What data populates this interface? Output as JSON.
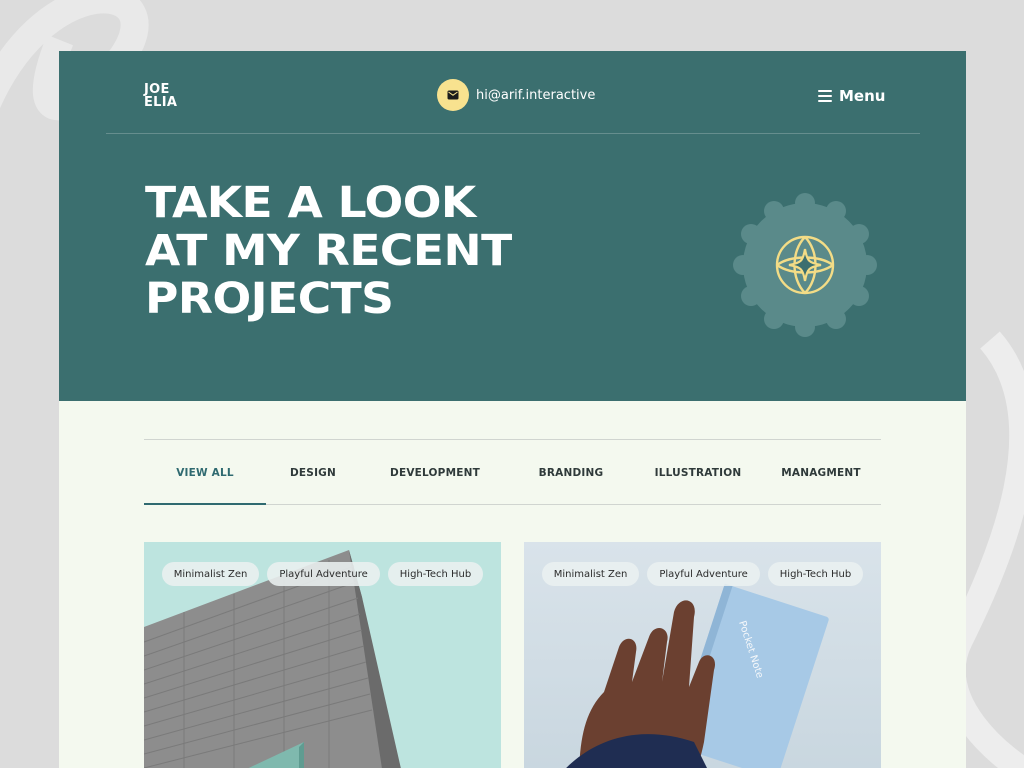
{
  "brand": {
    "line1": "JOE",
    "line2": "ELIA"
  },
  "contact": {
    "email": "hi@arif.interactive"
  },
  "menu": {
    "label": "Menu"
  },
  "hero": {
    "headline": [
      "TAKE A LOOK",
      "AT MY RECENT",
      "PROJECTS"
    ]
  },
  "tabs": [
    {
      "label": "VIEW ALL",
      "active": true
    },
    {
      "label": "DESIGN",
      "active": false
    },
    {
      "label": "DEVELOPMENT",
      "active": false
    },
    {
      "label": "BRANDING",
      "active": false
    },
    {
      "label": "ILLUSTRATION",
      "active": false
    },
    {
      "label": "MANAGMENT",
      "active": false
    }
  ],
  "cards": [
    {
      "tags": [
        "Minimalist Zen",
        "Playful Adventure",
        "High-Tech Hub"
      ],
      "image": "building-facade"
    },
    {
      "tags": [
        "Minimalist Zen",
        "Playful Adventure",
        "High-Tech Hub"
      ],
      "image": "hand-holding-notebook",
      "notebook_text": "Pocket Note"
    }
  ],
  "icons": {
    "mail": "mail-icon",
    "menu": "hamburger-icon",
    "badge": "globe-sparkle-icon"
  },
  "colors": {
    "hero_bg": "#3b6f6f",
    "accent_yellow": "#f8e28f",
    "page_bg": "#f4f9ef",
    "active_tab": "#2f6a70"
  }
}
